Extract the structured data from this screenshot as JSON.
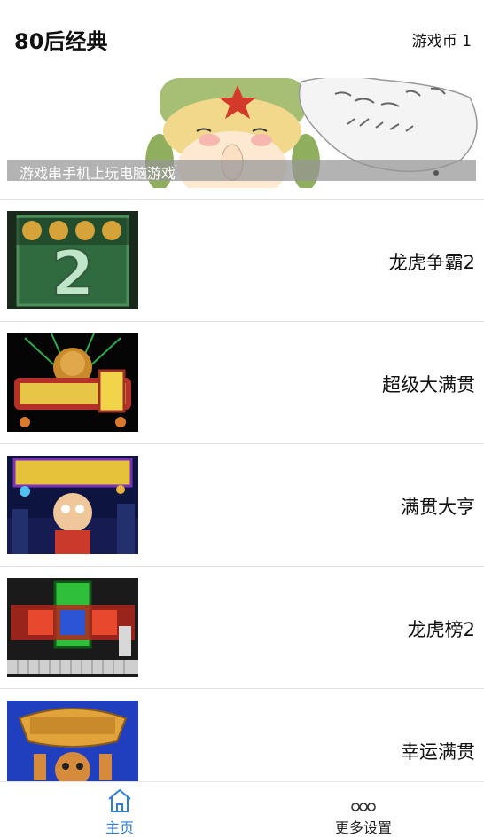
{
  "header": {
    "title": "80后经典",
    "coins": "游戏币 1"
  },
  "banner": {
    "caption": "游戏串手机上玩电脑游戏"
  },
  "games": [
    {
      "title": "龙虎争霸2"
    },
    {
      "title": "超级大满贯"
    },
    {
      "title": "满贯大亨"
    },
    {
      "title": "龙虎榜2"
    },
    {
      "title": "幸运满贯"
    }
  ],
  "tabbar": {
    "home_label": "主页",
    "more_label": "更多设置",
    "home_icon": "home-icon",
    "more_icon": "more-dots-icon",
    "active_color": "#2f7fd8"
  }
}
